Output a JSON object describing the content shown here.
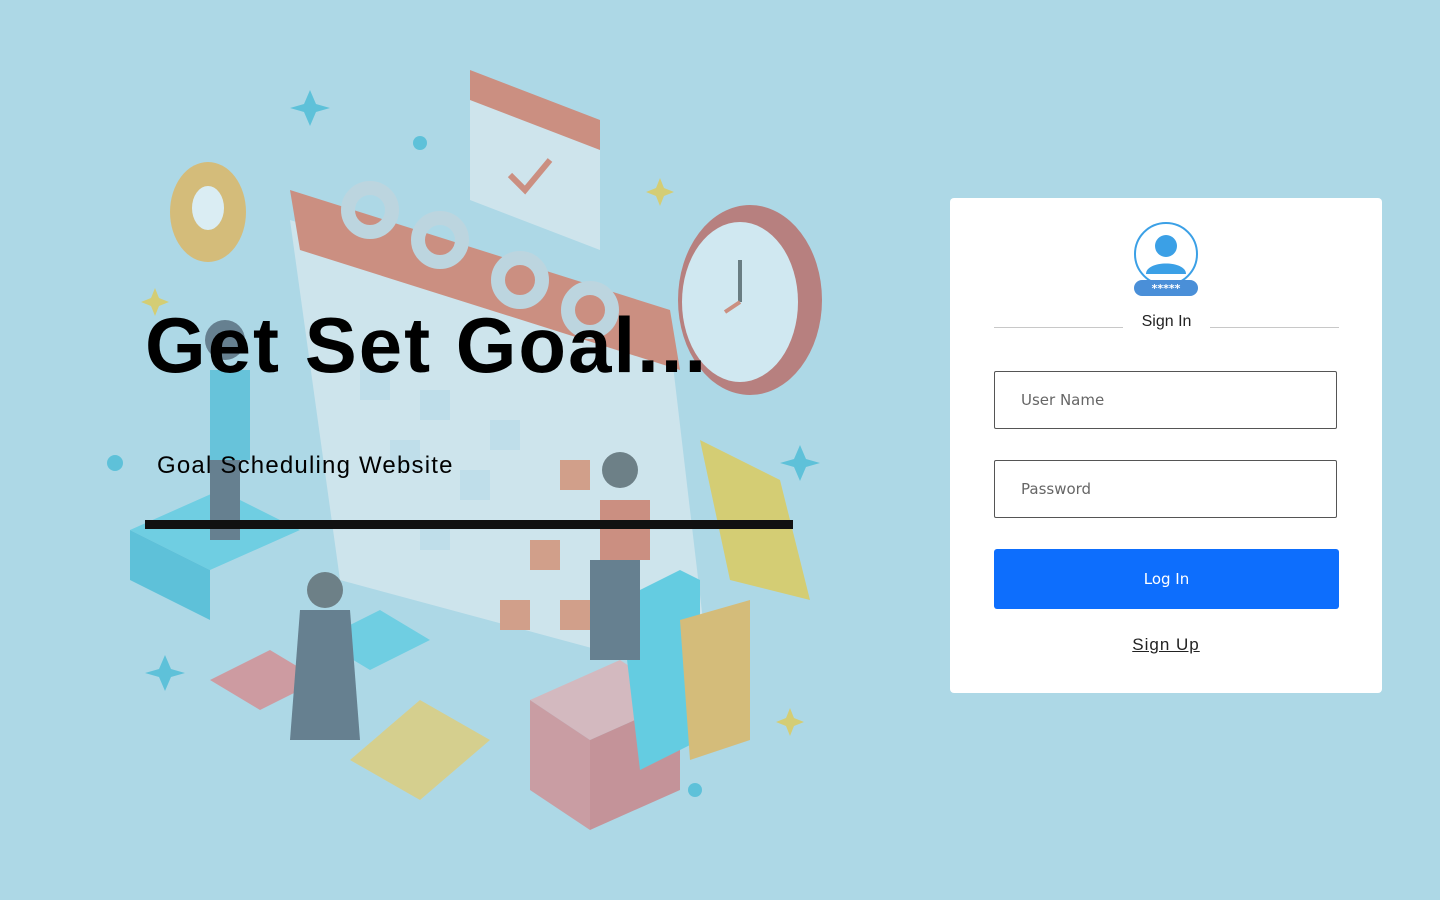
{
  "hero": {
    "title": "Get Set Goal...",
    "subtitle": "Goal Scheduling Website"
  },
  "login": {
    "avatar_icon": "user-lock-icon",
    "heading": "Sign In",
    "username_placeholder": "User Name",
    "password_placeholder": "Password",
    "login_button": "Log In",
    "signup_link": "Sign Up",
    "password_mask": "*****"
  },
  "colors": {
    "background": "#add8e6",
    "primary_button": "#0d6efd",
    "avatar_blue": "#3ba0e6"
  }
}
